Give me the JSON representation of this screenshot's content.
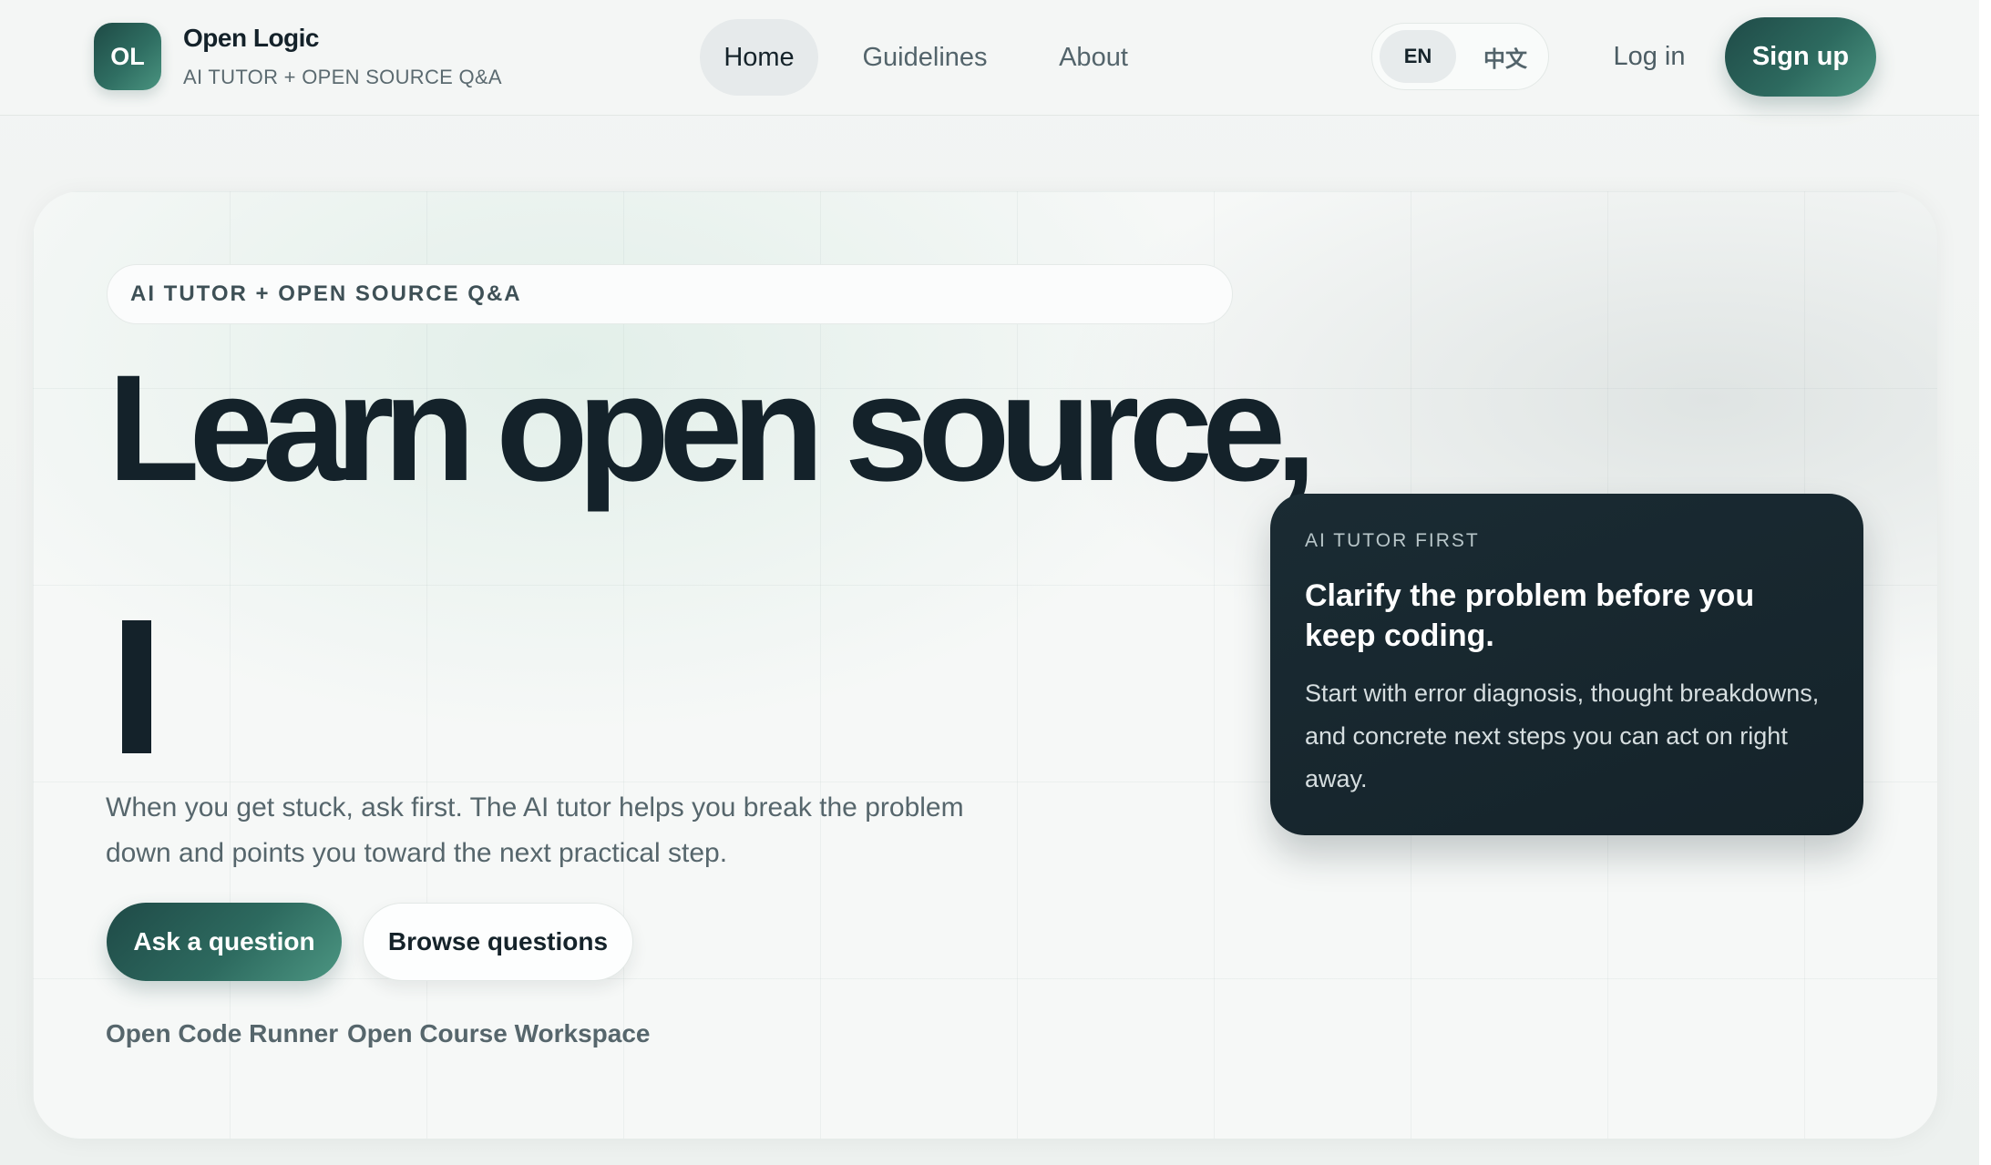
{
  "header": {
    "logo_text": "OL",
    "brand_name": "Open Logic",
    "brand_subtitle": "AI TUTOR + OPEN SOURCE Q&A",
    "nav": {
      "home": "Home",
      "guidelines": "Guidelines",
      "about": "About"
    },
    "lang": {
      "en": "EN",
      "zh": "中文",
      "selected": "EN"
    },
    "login": "Log in",
    "signup": "Sign up"
  },
  "hero": {
    "eyebrow": "AI TUTOR + OPEN SOURCE Q&A",
    "headline": "Learn open source,",
    "description": "When you get stuck, ask first. The AI tutor helps you break the problem down and points you toward the next practical step.",
    "primary_button": "Ask a question",
    "secondary_button": "Browse questions",
    "links": {
      "code_runner": "Open Code Runner",
      "course_workspace": "Open Course Workspace"
    }
  },
  "tutor_card": {
    "eyebrow": "AI TUTOR FIRST",
    "title": "Clarify the problem before you keep coding.",
    "body": "Start with error diagnosis, thought breakdowns, and concrete next steps you can act on right away."
  },
  "colors": {
    "accent_dark": "#1f4a47",
    "accent_light": "#4c9682",
    "ink": "#14222a",
    "muted": "#56666c",
    "card_dark": "#15232a"
  }
}
